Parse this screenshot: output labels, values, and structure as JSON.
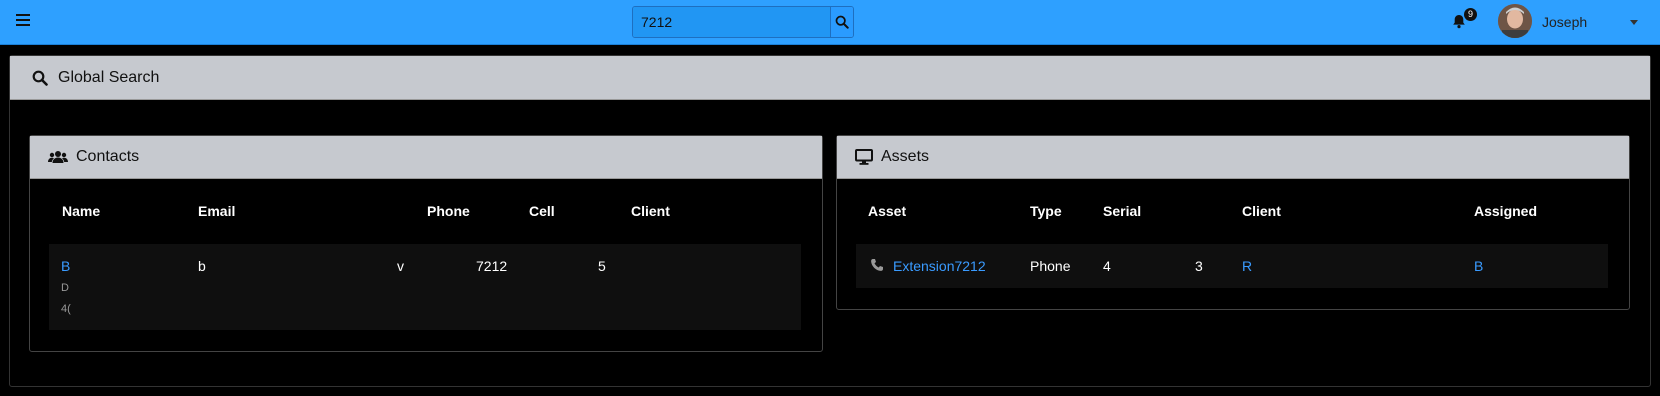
{
  "topbar": {
    "search_value": "7212",
    "notification_count": "9",
    "username": "Joseph"
  },
  "page": {
    "title": "Global Search"
  },
  "contacts": {
    "title": "Contacts",
    "columns": [
      "Name",
      "Email",
      "Phone",
      "Cell",
      "Client"
    ],
    "row": {
      "name": "B",
      "name_sub1": "D",
      "name_sub2": "4(",
      "email": "b",
      "email_extra": "v",
      "phone": "7212",
      "cell": "5",
      "client": ""
    }
  },
  "assets": {
    "title": "Assets",
    "columns": [
      "Asset",
      "Type",
      "Serial",
      "Client",
      "Assigned"
    ],
    "row": {
      "icon": "phone-icon",
      "asset": "Extension7212",
      "type": "Phone",
      "serial_a": "4",
      "serial_b": "3",
      "client": "R",
      "assigned": "B"
    }
  }
}
